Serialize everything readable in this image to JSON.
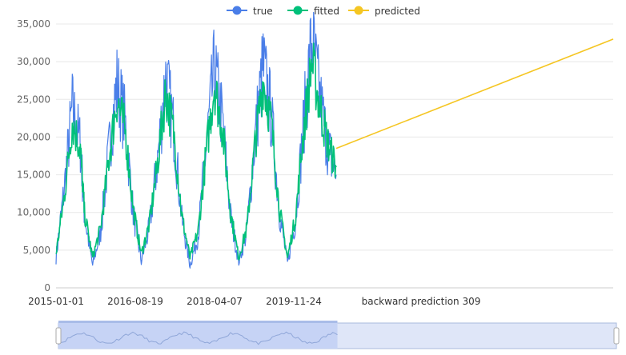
{
  "chart_data": {
    "type": "line",
    "title": "",
    "xlabel": "",
    "ylabel": "",
    "ylim": [
      0,
      35000
    ],
    "yticks": [
      0,
      5000,
      10000,
      15000,
      20000,
      25000,
      30000,
      35000
    ],
    "ytick_labels": [
      "0",
      "5,000",
      "10,000",
      "15,000",
      "20,000",
      "25,000",
      "30,000",
      "35,000"
    ],
    "xtick_labels": [
      "2015-01-01",
      "2016-08-19",
      "2018-04-07",
      "2019-11-24",
      "backward prediction 309"
    ],
    "grid": true,
    "legend_position": "top-center",
    "series": [
      {
        "name": "true",
        "color": "#4a7ee8",
        "x": [
          "2015-01",
          "2015-03",
          "2015-05",
          "2015-07",
          "2015-08",
          "2015-10",
          "2015-12",
          "2016-02",
          "2016-04",
          "2016-06",
          "2016-08",
          "2016-10",
          "2016-12",
          "2017-02",
          "2017-04",
          "2017-06",
          "2017-08",
          "2017-10",
          "2017-12",
          "2018-02",
          "2018-04",
          "2018-06",
          "2018-08",
          "2018-10",
          "2018-12",
          "2019-02",
          "2019-04",
          "2019-06",
          "2019-08",
          "2019-10",
          "2019-12",
          "2020-02",
          "2020-04",
          "2020-06",
          "2020-08",
          "2020-10"
        ],
        "values": [
          4000,
          13000,
          24000,
          19000,
          9500,
          3000,
          7500,
          18000,
          27000,
          22000,
          10000,
          3500,
          8000,
          17000,
          28000,
          21000,
          9000,
          3000,
          7000,
          19000,
          29000,
          22000,
          9500,
          3500,
          7500,
          20000,
          29500,
          23000,
          10000,
          3200,
          9000,
          22000,
          33000,
          25000,
          18500,
          15000
        ]
      },
      {
        "name": "fitted",
        "color": "#00c07a",
        "x": [
          "2015-01",
          "2015-03",
          "2015-05",
          "2015-07",
          "2015-08",
          "2015-10",
          "2015-12",
          "2016-02",
          "2016-04",
          "2016-06",
          "2016-08",
          "2016-10",
          "2016-12",
          "2017-02",
          "2017-04",
          "2017-06",
          "2017-08",
          "2017-10",
          "2017-12",
          "2018-02",
          "2018-04",
          "2018-06",
          "2018-08",
          "2018-10",
          "2018-12",
          "2019-02",
          "2019-04",
          "2019-06",
          "2019-08",
          "2019-10",
          "2019-12",
          "2020-02",
          "2020-04",
          "2020-06",
          "2020-08",
          "2020-10"
        ],
        "values": [
          4500,
          12000,
          22000,
          18500,
          10000,
          4000,
          8000,
          17000,
          25000,
          21000,
          10500,
          4500,
          8500,
          16500,
          26000,
          20500,
          9500,
          4000,
          7500,
          18000,
          27000,
          21000,
          10000,
          4000,
          8000,
          19000,
          27500,
          22000,
          10500,
          4000,
          9500,
          21000,
          30000,
          24000,
          19000,
          16000
        ]
      },
      {
        "name": "predicted",
        "color": "#f5c623",
        "x": [
          "2020-10",
          "backward prediction 309"
        ],
        "values": [
          18500,
          33000
        ]
      }
    ]
  },
  "datazoom": {
    "selected_fraction_start": 0.0,
    "selected_fraction_end": 0.5,
    "fill_color": "#dfe6f8",
    "selected_color": "#c6d3f5",
    "border_color": "#aabbdd"
  }
}
